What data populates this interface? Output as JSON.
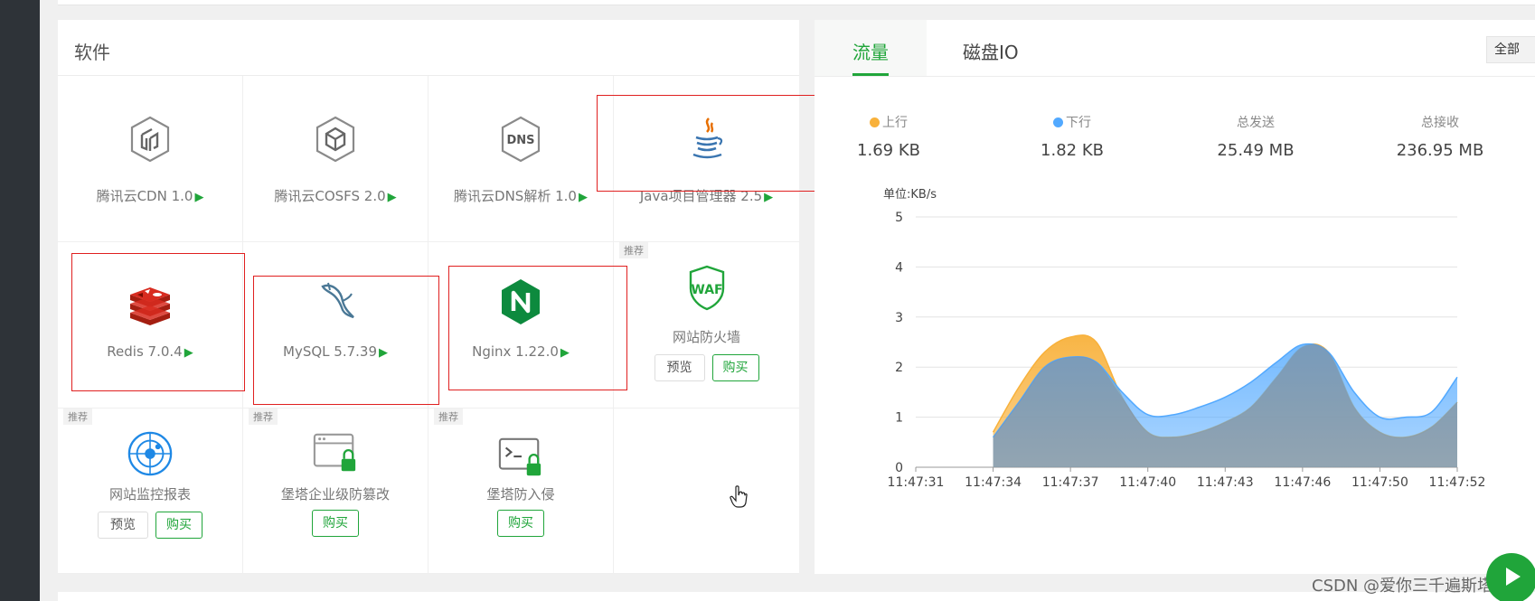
{
  "software_panel": {
    "title": "软件",
    "items": [
      {
        "name": "腾讯云CDN 1.0",
        "icon": "tencent-cdn-icon",
        "play": "▶"
      },
      {
        "name": "腾讯云COSFS 2.0",
        "icon": "tencent-cosfs-icon",
        "play": "▶"
      },
      {
        "name": "腾讯云DNS解析 1.0",
        "icon": "dns-icon",
        "play": "▶"
      },
      {
        "name": "Java项目管理器 2.5",
        "icon": "java-icon",
        "play": "▶"
      },
      {
        "name": "Redis 7.0.4",
        "icon": "redis-icon",
        "play": "▶"
      },
      {
        "name": "MySQL 5.7.39",
        "icon": "mysql-icon",
        "play": "▶"
      },
      {
        "name": "Nginx 1.22.0",
        "icon": "nginx-icon",
        "play": "▶"
      },
      {
        "name": "网站防火墙",
        "icon": "waf-icon",
        "tag": "推荐",
        "preview": "预览",
        "buy": "购买"
      },
      {
        "name": "网站监控报表",
        "icon": "monitor-report-icon",
        "tag": "推荐",
        "preview": "预览",
        "buy": "购买"
      },
      {
        "name": "堡塔企业级防篡改",
        "icon": "tamper-proof-icon",
        "tag": "推荐",
        "buy": "购买"
      },
      {
        "name": "堡塔防入侵",
        "icon": "intrusion-defense-icon",
        "tag": "推荐",
        "buy": "购买"
      }
    ]
  },
  "traffic_panel": {
    "tabs": [
      "流量",
      "磁盘IO"
    ],
    "active_tab": "流量",
    "range_select": "全部",
    "stats": [
      {
        "label": "上行",
        "value": "1.69 KB",
        "color": "#f8b13b"
      },
      {
        "label": "下行",
        "value": "1.82 KB",
        "color": "#52a9ff"
      },
      {
        "label": "总发送",
        "value": "25.49 MB"
      },
      {
        "label": "总接收",
        "value": "236.95 MB"
      }
    ]
  },
  "chart_data": {
    "type": "area",
    "ylabel": "单位:KB/s",
    "ylim": [
      0,
      5
    ],
    "yticks": [
      0,
      1,
      2,
      3,
      4,
      5
    ],
    "x": [
      "11:47:31",
      "11:47:34",
      "11:47:37",
      "11:47:40",
      "11:47:43",
      "11:47:46",
      "11:47:50",
      "11:47:52"
    ],
    "grid": true,
    "series": [
      {
        "name": "上行",
        "color": "#f8b13b",
        "x": [
          34,
          35,
          36,
          37,
          38,
          39,
          40,
          41,
          42,
          43,
          44,
          45,
          46,
          47,
          48,
          49,
          50,
          51,
          52
        ],
        "values": [
          0.7,
          1.6,
          2.3,
          2.6,
          2.5,
          1.4,
          0.7,
          0.6,
          0.7,
          0.9,
          1.2,
          1.8,
          2.4,
          2.3,
          1.2,
          0.7,
          0.6,
          0.8,
          1.3
        ]
      },
      {
        "name": "下行",
        "color": "#52a9ff",
        "x": [
          34,
          35,
          36,
          37,
          38,
          39,
          40,
          41,
          42,
          43,
          44,
          45,
          46,
          47,
          48,
          49,
          50,
          51,
          52
        ],
        "values": [
          0.6,
          1.3,
          2.0,
          2.2,
          2.1,
          1.5,
          1.05,
          1.05,
          1.2,
          1.4,
          1.7,
          2.1,
          2.45,
          2.3,
          1.5,
          1.0,
          1.0,
          1.1,
          1.8
        ]
      }
    ]
  },
  "watermark": "CSDN @爱你三千遍斯塔克"
}
